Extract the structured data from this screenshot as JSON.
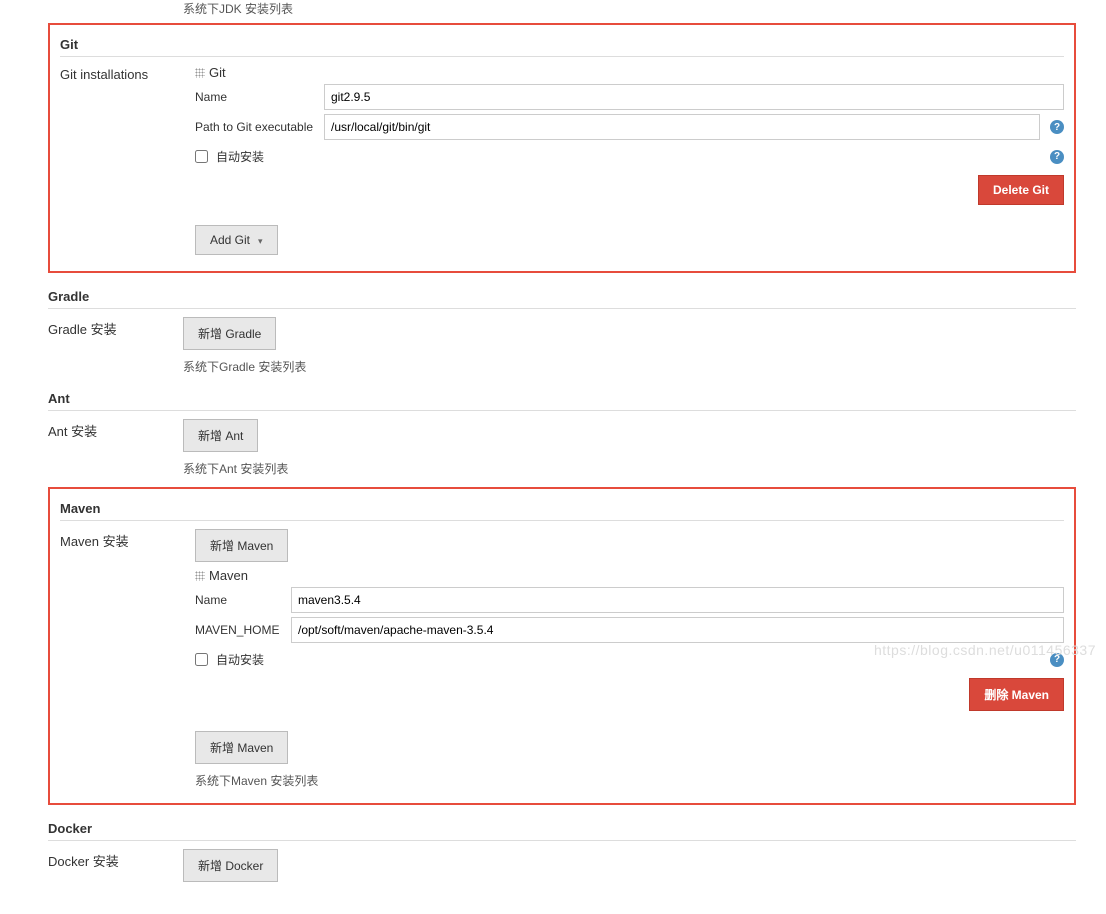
{
  "jdk_hint": "系统下JDK 安装列表",
  "git": {
    "title": "Git",
    "installations_label": "Git installations",
    "tool_name": "Git",
    "name_label": "Name",
    "name_value": "git2.9.5",
    "path_label": "Path to Git executable",
    "path_value": "/usr/local/git/bin/git",
    "auto_install_label": "自动安装",
    "delete_btn": "Delete Git",
    "add_btn": "Add Git"
  },
  "gradle": {
    "title": "Gradle",
    "install_label": "Gradle 安装",
    "add_btn": "新增 Gradle",
    "hint": "系统下Gradle 安装列表"
  },
  "ant": {
    "title": "Ant",
    "install_label": "Ant 安装",
    "add_btn": "新增 Ant",
    "hint": "系统下Ant 安装列表"
  },
  "maven": {
    "title": "Maven",
    "install_label": "Maven 安装",
    "add_btn_top": "新增 Maven",
    "tool_name": "Maven",
    "name_label": "Name",
    "name_value": "maven3.5.4",
    "home_label": "MAVEN_HOME",
    "home_value": "/opt/soft/maven/apache-maven-3.5.4",
    "auto_install_label": "自动安装",
    "delete_btn": "删除 Maven",
    "add_btn_bottom": "新增 Maven",
    "hint": "系统下Maven 安装列表"
  },
  "docker": {
    "title": "Docker",
    "install_label": "Docker 安装",
    "add_btn": "新增 Docker"
  },
  "watermark": "https://blog.csdn.net/u011456337"
}
